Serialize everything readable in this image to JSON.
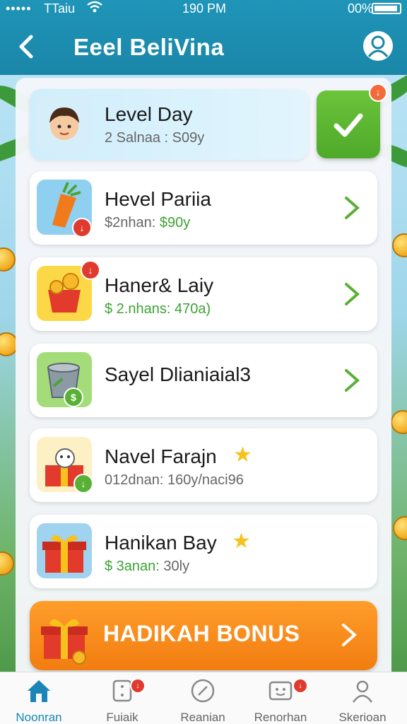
{
  "status_bar": {
    "signal": "•••••",
    "carrier": "TTaiu",
    "time": "190 PM",
    "battery": "00%"
  },
  "header": {
    "title": "Eeel BeliVina"
  },
  "cards": [
    {
      "title": "Level Day",
      "subtitle": "2 Salnaa : S09y"
    },
    {
      "title": "Hevel Pariia",
      "subtitle_prefix": "$2nhan: ",
      "subtitle_value": "$90y",
      "badge": "↓"
    },
    {
      "title": "Haner& Laiy",
      "subtitle_prefix": "$ 2.nhans: ",
      "subtitle_value": "470a)",
      "badge": "↓"
    },
    {
      "title": "Sayel Dlianiaial3",
      "badge": "$"
    },
    {
      "title": "Navel Farajn",
      "subtitle": "012dnan: 160y/naci96",
      "badge": "↓"
    },
    {
      "title": "Hanikan Bay",
      "subtitle_prefix": "$ 3anan: ",
      "subtitle_value": "30ly"
    }
  ],
  "check_badge": "↓",
  "bonus": {
    "label": "HADIKAH BONUS"
  },
  "tabs": [
    {
      "label": "Noonran"
    },
    {
      "label": "Fuiaik",
      "badge": "↓"
    },
    {
      "label": "Reanian"
    },
    {
      "label": "Renorhan",
      "badge": "↓"
    },
    {
      "label": "Skerioan"
    }
  ],
  "colors": {
    "header": "#1f95b8",
    "accent_green": "#58b135",
    "bonus_orange": "#f5871a",
    "badge_red": "#e03a2f",
    "active_tab": "#1a86b8"
  }
}
